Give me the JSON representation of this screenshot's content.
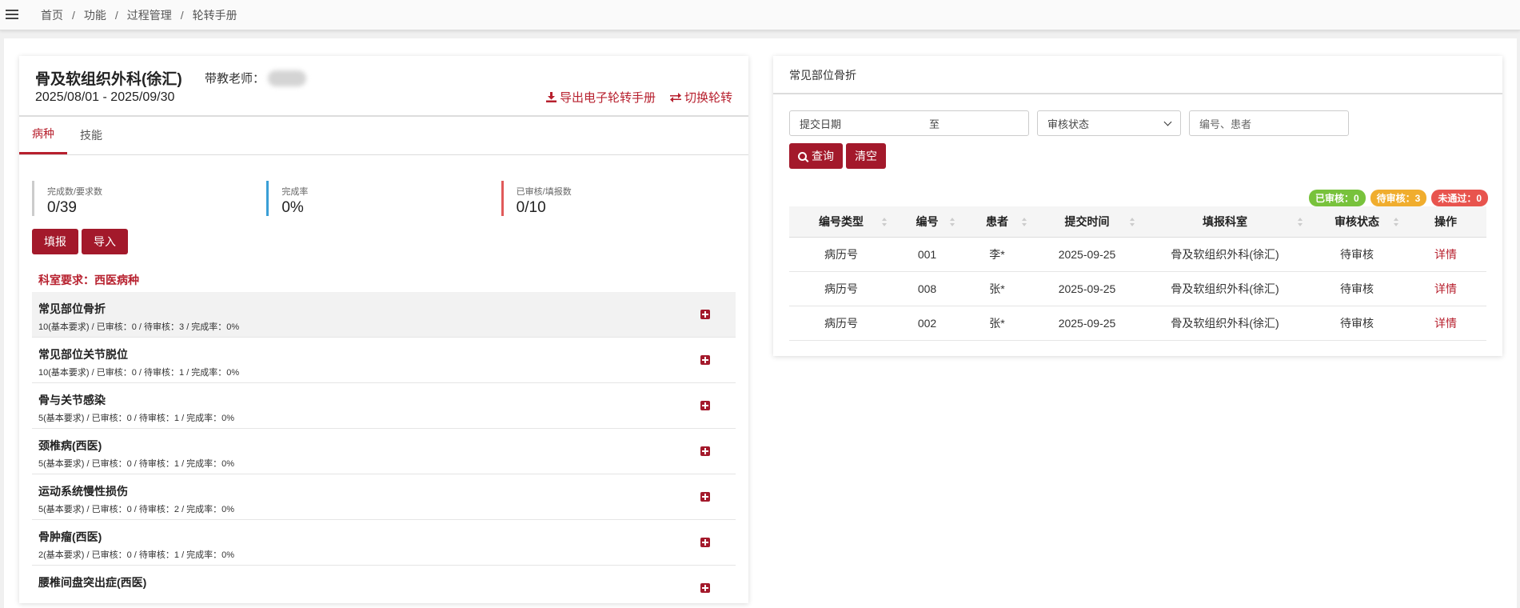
{
  "breadcrumb": [
    "首页",
    "功能",
    "过程管理",
    "轮转手册"
  ],
  "rotation": {
    "title": "骨及软组织外科(徐汇)",
    "teacher_label": "带教老师：",
    "date_range": "2025/08/01 - 2025/09/30",
    "export_label": "导出电子轮转手册",
    "switch_label": "切换轮转"
  },
  "tabs": [
    "病种",
    "技能"
  ],
  "stats": [
    {
      "label": "完成数/要求数",
      "value": "0/39"
    },
    {
      "label": "完成率",
      "value": "0%"
    },
    {
      "label": "已审核/填报数",
      "value": "0/10"
    }
  ],
  "buttons": {
    "fill": "填报",
    "import": "导入"
  },
  "dept_requirement": "科室要求：西医病种",
  "items": [
    {
      "name": "常见部位骨折",
      "info": "10(基本要求) / 已审核：0 / 待审核：3 / 完成率：0%"
    },
    {
      "name": "常见部位关节脱位",
      "info": "10(基本要求) / 已审核：0 / 待审核：1 / 完成率：0%"
    },
    {
      "name": "骨与关节感染",
      "info": "5(基本要求) / 已审核：0 / 待审核：1 / 完成率：0%"
    },
    {
      "name": "颈椎病(西医)",
      "info": "5(基本要求) / 已审核：0 / 待审核：1 / 完成率：0%"
    },
    {
      "name": "运动系统慢性损伤",
      "info": "5(基本要求) / 已审核：0 / 待审核：2 / 完成率：0%"
    },
    {
      "name": "骨肿瘤(西医)",
      "info": "2(基本要求) / 已审核：0 / 待审核：1 / 完成率：0%"
    },
    {
      "name": "腰椎间盘突出症(西医)",
      "info": ""
    }
  ],
  "detail": {
    "title": "常见部位骨折",
    "date_placeholder": "提交日期",
    "date_to": "至",
    "status_select": "审核状态",
    "keyword_placeholder": "编号、患者",
    "query_label": "查询",
    "clear_label": "清空",
    "badges": [
      {
        "text": "已审核：0",
        "color": "#78c23c"
      },
      {
        "text": "待审核：3",
        "color": "#f0ad2e"
      },
      {
        "text": "未通过：0",
        "color": "#e8544e"
      }
    ],
    "columns": [
      "编号类型",
      "编号",
      "患者",
      "提交时间",
      "填报科室",
      "审核状态",
      "操作"
    ],
    "rows": [
      [
        "病历号",
        "001",
        "李*",
        "2025-09-25",
        "骨及软组织外科(徐汇)",
        "待审核",
        "详情"
      ],
      [
        "病历号",
        "008",
        "张*",
        "2025-09-25",
        "骨及软组织外科(徐汇)",
        "待审核",
        "详情"
      ],
      [
        "病历号",
        "002",
        "张*",
        "2025-09-25",
        "骨及软组织外科(徐汇)",
        "待审核",
        "详情"
      ]
    ]
  },
  "accent_color": "#a3192b"
}
